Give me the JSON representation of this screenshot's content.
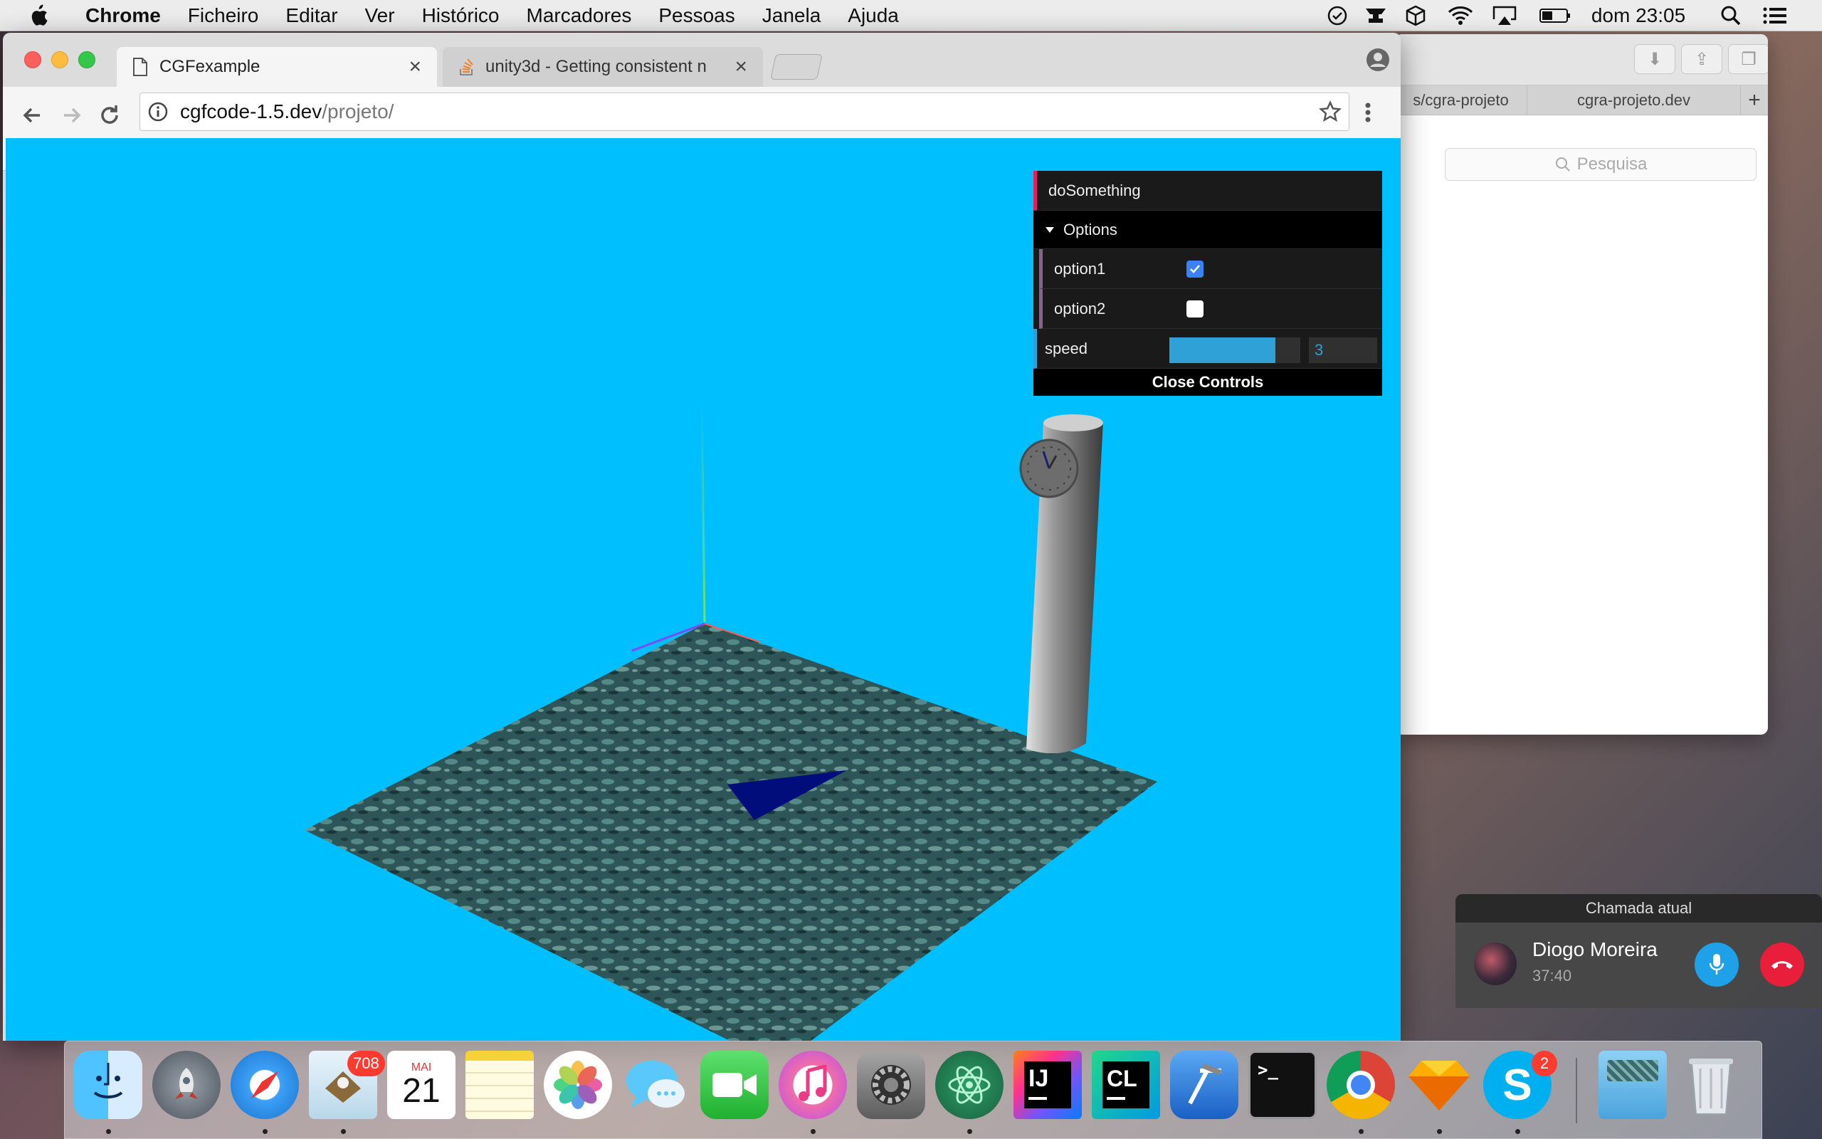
{
  "menubar": {
    "app": "Chrome",
    "items": [
      "Ficheiro",
      "Editar",
      "Ver",
      "Histórico",
      "Marcadores",
      "Pessoas",
      "Janela",
      "Ajuda"
    ],
    "clock": "dom 23:05"
  },
  "safari": {
    "tab1": "s/cgra-projeto",
    "tab2": "cgra-projeto.dev",
    "new_tab": "+",
    "search_placeholder": "Pesquisa"
  },
  "chrome": {
    "tabs": [
      {
        "title": "CGFexample",
        "close": "×"
      },
      {
        "title": "unity3d - Getting consistent n",
        "close": "×"
      }
    ],
    "url_host": "cgfcode-1.5.dev",
    "url_path": "/projeto/"
  },
  "gui": {
    "do_something": "doSomething",
    "options_folder": "Options",
    "option1": {
      "label": "option1",
      "checked": true
    },
    "option2": {
      "label": "option2",
      "checked": false
    },
    "speed": {
      "label": "speed",
      "value": "3",
      "fill_fraction": 0.81
    },
    "close_label": "Close Controls"
  },
  "call": {
    "header": "Chamada atual",
    "name": "Diogo Moreira",
    "duration": "37:40"
  },
  "dock": {
    "mail_badge": "708",
    "calendar_month": "MAI",
    "calendar_day": "21",
    "skype_badge": "2",
    "intellij_label": "IJ",
    "clion_label": "CL",
    "terminal_prompt": ">_"
  },
  "colors": {
    "scene_bg": "#00bfff",
    "gui_bg": "#1a1a1a",
    "gui_accent": "#e61d5f",
    "slider_fill": "#2fa1d6"
  }
}
